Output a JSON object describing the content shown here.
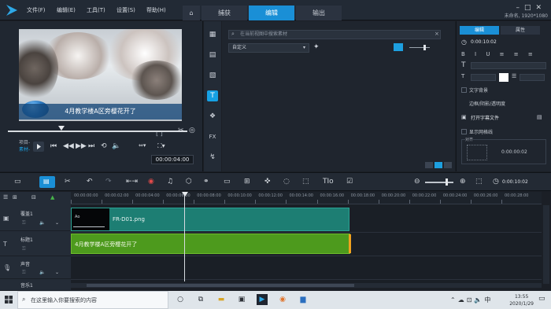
{
  "menu": [
    "文件(F)",
    "编辑(E)",
    "工具(T)",
    "设置(S)",
    "帮助(H)"
  ],
  "modes": {
    "capture": "捕获",
    "edit": "编辑",
    "share": "输出"
  },
  "project_info": "未命名, 1920*1080",
  "preview": {
    "caption": "4月教学楼A区旁樱花开了",
    "project_label": "项目-",
    "clip_label": "素材-",
    "timecode": "00:00:04:00"
  },
  "library": {
    "search_placeholder": "在当前视图中搜索素材",
    "category": "自定义"
  },
  "options": {
    "tab_edit": "编辑",
    "tab_attr": "属性",
    "duration": "0:00:10:02",
    "text_background": "文字背景",
    "border_shadow": "边框/阴影/透明度",
    "open_subtitle": "打开字幕文件",
    "show_grid": "显示网格线",
    "align_label": "对齐",
    "rotate_time": "0:00:00:02"
  },
  "timeline": {
    "ruler_labels": [
      "00:00:00:00",
      "00:00:02:00",
      "00:00:04:00",
      "00:00:06:00",
      "00:00:08:00",
      "00:00:10:00",
      "00:00:12:00",
      "00:00:14:00",
      "00:00:16:00",
      "00:00:18:00",
      "00:00:20:00",
      "00:00:22:00",
      "00:00:24:00",
      "00:00:26:00",
      "00:00:28:00"
    ],
    "tracks": [
      {
        "name": "覆盖1"
      },
      {
        "name": "标题1"
      },
      {
        "name": "声音"
      },
      {
        "name": "音乐1"
      }
    ],
    "video_clip": "FR-D01.png",
    "title_clip": "4月教学楼A区旁樱花开了"
  },
  "taskbar": {
    "search_placeholder": "在这里输入你要搜索的内容",
    "time": "13:55",
    "date": "2020/1/29"
  }
}
